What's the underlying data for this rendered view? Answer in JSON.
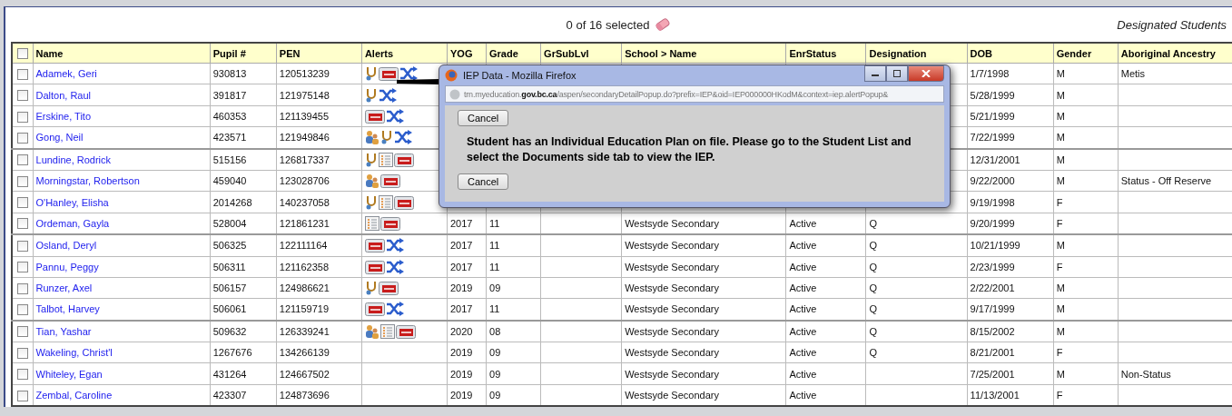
{
  "toolbar": {
    "selection": "0 of 16 selected",
    "view_title": "Designated Students"
  },
  "table": {
    "select_all": {
      "checked": false
    },
    "columns": [
      "Name",
      "Pupil #",
      "PEN",
      "Alerts",
      "YOG",
      "Grade",
      "GrSubLvl",
      "School > Name",
      "EnrStatus",
      "Designation",
      "DOB",
      "Gender",
      "Aboriginal Ancestry"
    ],
    "rows": [
      {
        "checked": false,
        "name": "Adamek, Geri",
        "pupil": "930813",
        "pen": "120513239",
        "alerts": [
          {
            "kind": "medical"
          },
          {
            "kind": "iep"
          },
          {
            "kind": "shuffle"
          }
        ],
        "dob": "1/7/1998",
        "gender": "M",
        "ancestry": "Metis"
      },
      {
        "checked": false,
        "name": "Dalton, Raul",
        "pupil": "391817",
        "pen": "121975148",
        "alerts": [
          {
            "kind": "medical"
          },
          {
            "kind": "shuffle"
          }
        ],
        "dob": "5/28/1999",
        "gender": "M"
      },
      {
        "checked": false,
        "name": "Erskine, Tito",
        "pupil": "460353",
        "pen": "121139455",
        "alerts": [
          {
            "kind": "iep"
          },
          {
            "kind": "shuffle"
          }
        ],
        "dob": "5/21/1999",
        "gender": "M"
      },
      {
        "checked": false,
        "name": "Gong, Neil",
        "pupil": "423571",
        "pen": "121949846",
        "alerts": [
          {
            "kind": "family"
          },
          {
            "kind": "medical"
          },
          {
            "kind": "shuffle"
          }
        ],
        "dob": "7/22/1999",
        "gender": "M"
      },
      {
        "checked": false,
        "name": "Lundine, Rodrick",
        "pupil": "515156",
        "pen": "126817337",
        "alerts": [
          {
            "kind": "medical"
          },
          {
            "kind": "list"
          },
          {
            "kind": "iep"
          }
        ],
        "dob": "12/31/2001",
        "gender": "M"
      },
      {
        "checked": false,
        "name": "Morningstar, Robertson",
        "pupil": "459040",
        "pen": "123028706",
        "alerts": [
          {
            "kind": "family"
          },
          {
            "kind": "iep"
          }
        ],
        "dob": "9/22/2000",
        "gender": "M",
        "ancestry": "Status - Off Reserve"
      },
      {
        "checked": false,
        "name": "O'Hanley, Elisha",
        "pupil": "2014268",
        "pen": "140237058",
        "alerts": [
          {
            "kind": "medical"
          },
          {
            "kind": "list"
          },
          {
            "kind": "iep"
          }
        ],
        "dob": "9/19/1998",
        "gender": "F"
      },
      {
        "checked": false,
        "name": "Ordeman, Gayla",
        "pupil": "528004",
        "pen": "121861231",
        "alerts": [
          {
            "kind": "list"
          },
          {
            "kind": "iep"
          }
        ],
        "yog": "2017",
        "grade": "11",
        "school": "Westsyde Secondary",
        "enr": "Active",
        "designation": "Q",
        "dob": "9/20/1999",
        "gender": "F"
      },
      {
        "checked": false,
        "name": "Osland, Deryl",
        "pupil": "506325",
        "pen": "122111164",
        "alerts": [
          {
            "kind": "iep"
          },
          {
            "kind": "shuffle"
          }
        ],
        "yog": "2017",
        "grade": "11",
        "school": "Westsyde Secondary",
        "enr": "Active",
        "designation": "Q",
        "dob": "10/21/1999",
        "gender": "M"
      },
      {
        "checked": false,
        "name": "Pannu, Peggy",
        "pupil": "506311",
        "pen": "121162358",
        "alerts": [
          {
            "kind": "iep"
          },
          {
            "kind": "shuffle"
          }
        ],
        "yog": "2017",
        "grade": "11",
        "school": "Westsyde Secondary",
        "enr": "Active",
        "designation": "Q",
        "dob": "2/23/1999",
        "gender": "F"
      },
      {
        "checked": false,
        "name": "Runzer, Axel",
        "pupil": "506157",
        "pen": "124986621",
        "alerts": [
          {
            "kind": "medical"
          },
          {
            "kind": "iep"
          }
        ],
        "yog": "2019",
        "grade": "09",
        "school": "Westsyde Secondary",
        "enr": "Active",
        "designation": "Q",
        "dob": "2/22/2001",
        "gender": "M"
      },
      {
        "checked": false,
        "name": "Talbot, Harvey",
        "pupil": "506061",
        "pen": "121159719",
        "alerts": [
          {
            "kind": "iep"
          },
          {
            "kind": "shuffle"
          }
        ],
        "yog": "2017",
        "grade": "11",
        "school": "Westsyde Secondary",
        "enr": "Active",
        "designation": "Q",
        "dob": "9/17/1999",
        "gender": "M"
      },
      {
        "checked": false,
        "name": "Tian, Yashar",
        "pupil": "509632",
        "pen": "126339241",
        "alerts": [
          {
            "kind": "family"
          },
          {
            "kind": "list"
          },
          {
            "kind": "iep"
          }
        ],
        "yog": "2020",
        "grade": "08",
        "school": "Westsyde Secondary",
        "enr": "Active",
        "designation": "Q",
        "dob": "8/15/2002",
        "gender": "M"
      },
      {
        "checked": false,
        "name": "Wakeling, Christ'l",
        "pupil": "1267676",
        "pen": "134266139",
        "yog": "2019",
        "grade": "09",
        "school": "Westsyde Secondary",
        "enr": "Active",
        "designation": "Q",
        "dob": "8/21/2001",
        "gender": "F"
      },
      {
        "checked": false,
        "name": "Whiteley, Egan",
        "pupil": "431264",
        "pen": "124667502",
        "yog": "2019",
        "grade": "09",
        "school": "Westsyde Secondary",
        "enr": "Active",
        "dob": "7/25/2001",
        "gender": "M",
        "ancestry": "Non-Status"
      },
      {
        "checked": false,
        "name": "Zembal, Caroline",
        "pupil": "423307",
        "pen": "124873696",
        "yog": "2019",
        "grade": "09",
        "school": "Westsyde Secondary",
        "enr": "Active",
        "dob": "11/13/2001",
        "gender": "F"
      }
    ]
  },
  "popup": {
    "title": "IEP Data - Mozilla Firefox",
    "url": "trn.myeducation.**gov.bc.ca**/aspen/secondaryDetailPopup.do?prefix=IEP&oid=IEP000000HKodM&context=iep.alertPopup&",
    "buttons": [
      "Cancel",
      "Cancel"
    ],
    "message": "Student has an Individual Education Plan on file. Please go to the Student List and select the Documents side tab to view the IEP."
  }
}
